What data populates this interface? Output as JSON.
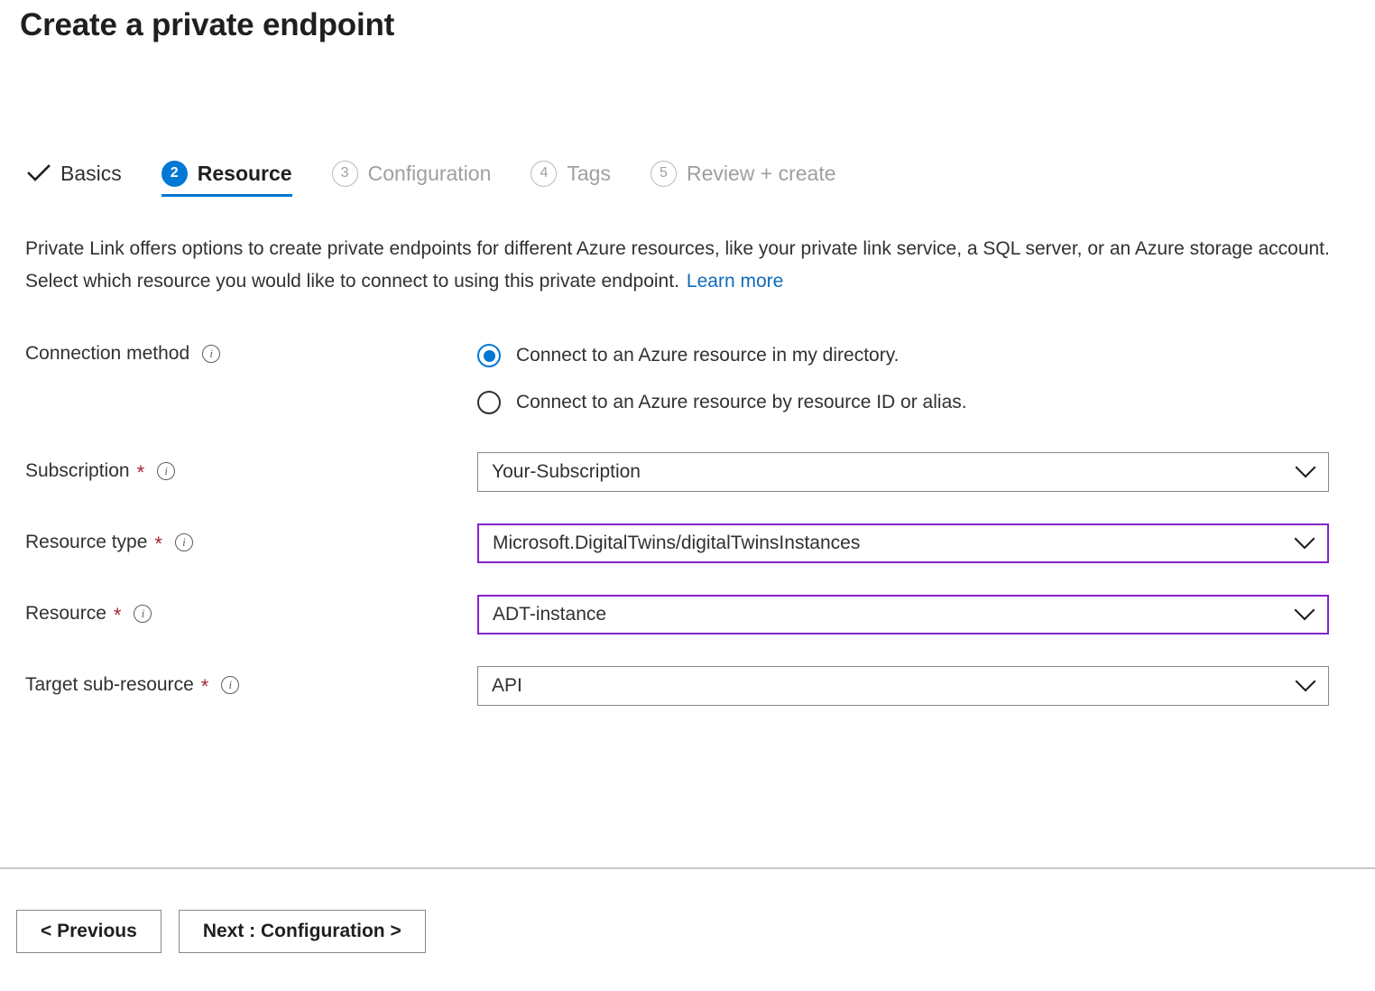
{
  "page": {
    "title": "Create a private endpoint"
  },
  "wizard": {
    "tabs": [
      {
        "label": "Basics",
        "step": "",
        "state": "done"
      },
      {
        "label": "Resource",
        "step": "2",
        "state": "active"
      },
      {
        "label": "Configuration",
        "step": "3",
        "state": "pending"
      },
      {
        "label": "Tags",
        "step": "4",
        "state": "pending"
      },
      {
        "label": "Review + create",
        "step": "5",
        "state": "pending"
      }
    ]
  },
  "intro": {
    "text": "Private Link offers options to create private endpoints for different Azure resources, like your private link service, a SQL server, or an Azure storage account. Select which resource you would like to connect to using this private endpoint.",
    "learn_more": "Learn more",
    "link_color": "#0f6cbd"
  },
  "form": {
    "connection_method": {
      "label": "Connection method",
      "options": [
        {
          "label": "Connect to an Azure resource in my directory.",
          "selected": true
        },
        {
          "label": "Connect to an Azure resource by resource ID or alias.",
          "selected": false
        }
      ]
    },
    "subscription": {
      "label": "Subscription",
      "required": "*",
      "value": "Your-Subscription",
      "highlighted": false
    },
    "resource_type": {
      "label": "Resource type",
      "required": "*",
      "value": "Microsoft.DigitalTwins/digitalTwinsInstances",
      "highlighted": true
    },
    "resource": {
      "label": "Resource",
      "required": "*",
      "value": "ADT-instance",
      "highlighted": true
    },
    "target_sub_resource": {
      "label": "Target sub-resource",
      "required": "*",
      "value": "API",
      "highlighted": true
    }
  },
  "footer": {
    "previous_label": "< Previous",
    "next_label": "Next : Configuration >"
  },
  "colors": {
    "accent_blue": "#0078d4",
    "highlight_purple": "#8423c8",
    "required_red": "#a4262c",
    "muted_grey": "#a19f9d"
  }
}
